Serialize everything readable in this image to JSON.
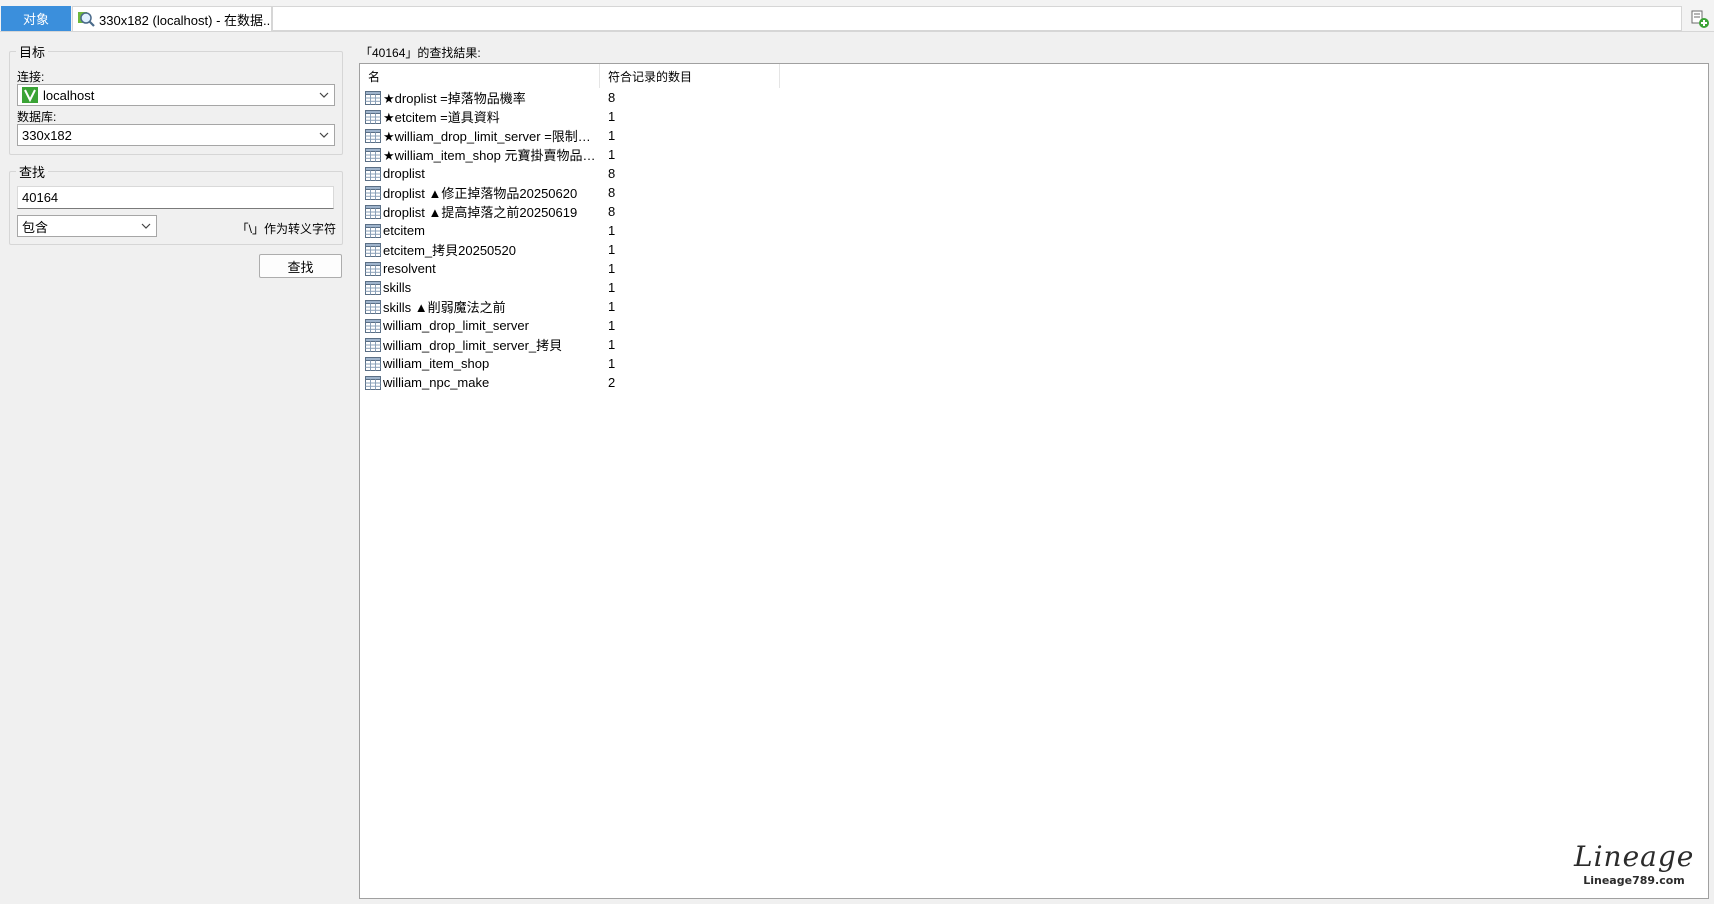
{
  "tabs": {
    "objects_label": "对象",
    "search_tab_label": "330x182 (localhost) - 在数据..."
  },
  "target": {
    "legend": "目标",
    "connection_label": "连接:",
    "connection_value": "localhost",
    "database_label": "数据库:",
    "database_value": "330x182"
  },
  "find": {
    "legend": "查找",
    "query": "40164",
    "match_mode": "包含",
    "escape_hint": "「\\」作为转义字符",
    "button_label": "查找"
  },
  "results": {
    "title": "「40164」的查找結果:",
    "columns": [
      "名",
      "符合记录的数目"
    ],
    "rows": [
      {
        "name": "★droplist =掉落物品機率",
        "count": "8"
      },
      {
        "name": "★etcitem =道具資料",
        "count": "1"
      },
      {
        "name": "★william_drop_limit_server =限制物...",
        "count": "1"
      },
      {
        "name": "★william_item_shop 元寶掛賣物品限制",
        "count": "1"
      },
      {
        "name": "droplist",
        "count": "8"
      },
      {
        "name": "droplist ▲修正掉落物品20250620",
        "count": "8"
      },
      {
        "name": "droplist ▲提高掉落之前20250619",
        "count": "8"
      },
      {
        "name": "etcitem",
        "count": "1"
      },
      {
        "name": "etcitem_拷貝20250520",
        "count": "1"
      },
      {
        "name": "resolvent",
        "count": "1"
      },
      {
        "name": "skills",
        "count": "1"
      },
      {
        "name": "skills ▲削弱魔法之前",
        "count": "1"
      },
      {
        "name": "william_drop_limit_server",
        "count": "1"
      },
      {
        "name": "william_drop_limit_server_拷貝",
        "count": "1"
      },
      {
        "name": "william_item_shop",
        "count": "1"
      },
      {
        "name": "william_npc_make",
        "count": "2"
      }
    ]
  },
  "watermark": {
    "logo": "Lineage",
    "site": "Lineage789.com"
  },
  "colors": {
    "accent": "#3b8fdc",
    "connection_icon": "#3aa335"
  }
}
